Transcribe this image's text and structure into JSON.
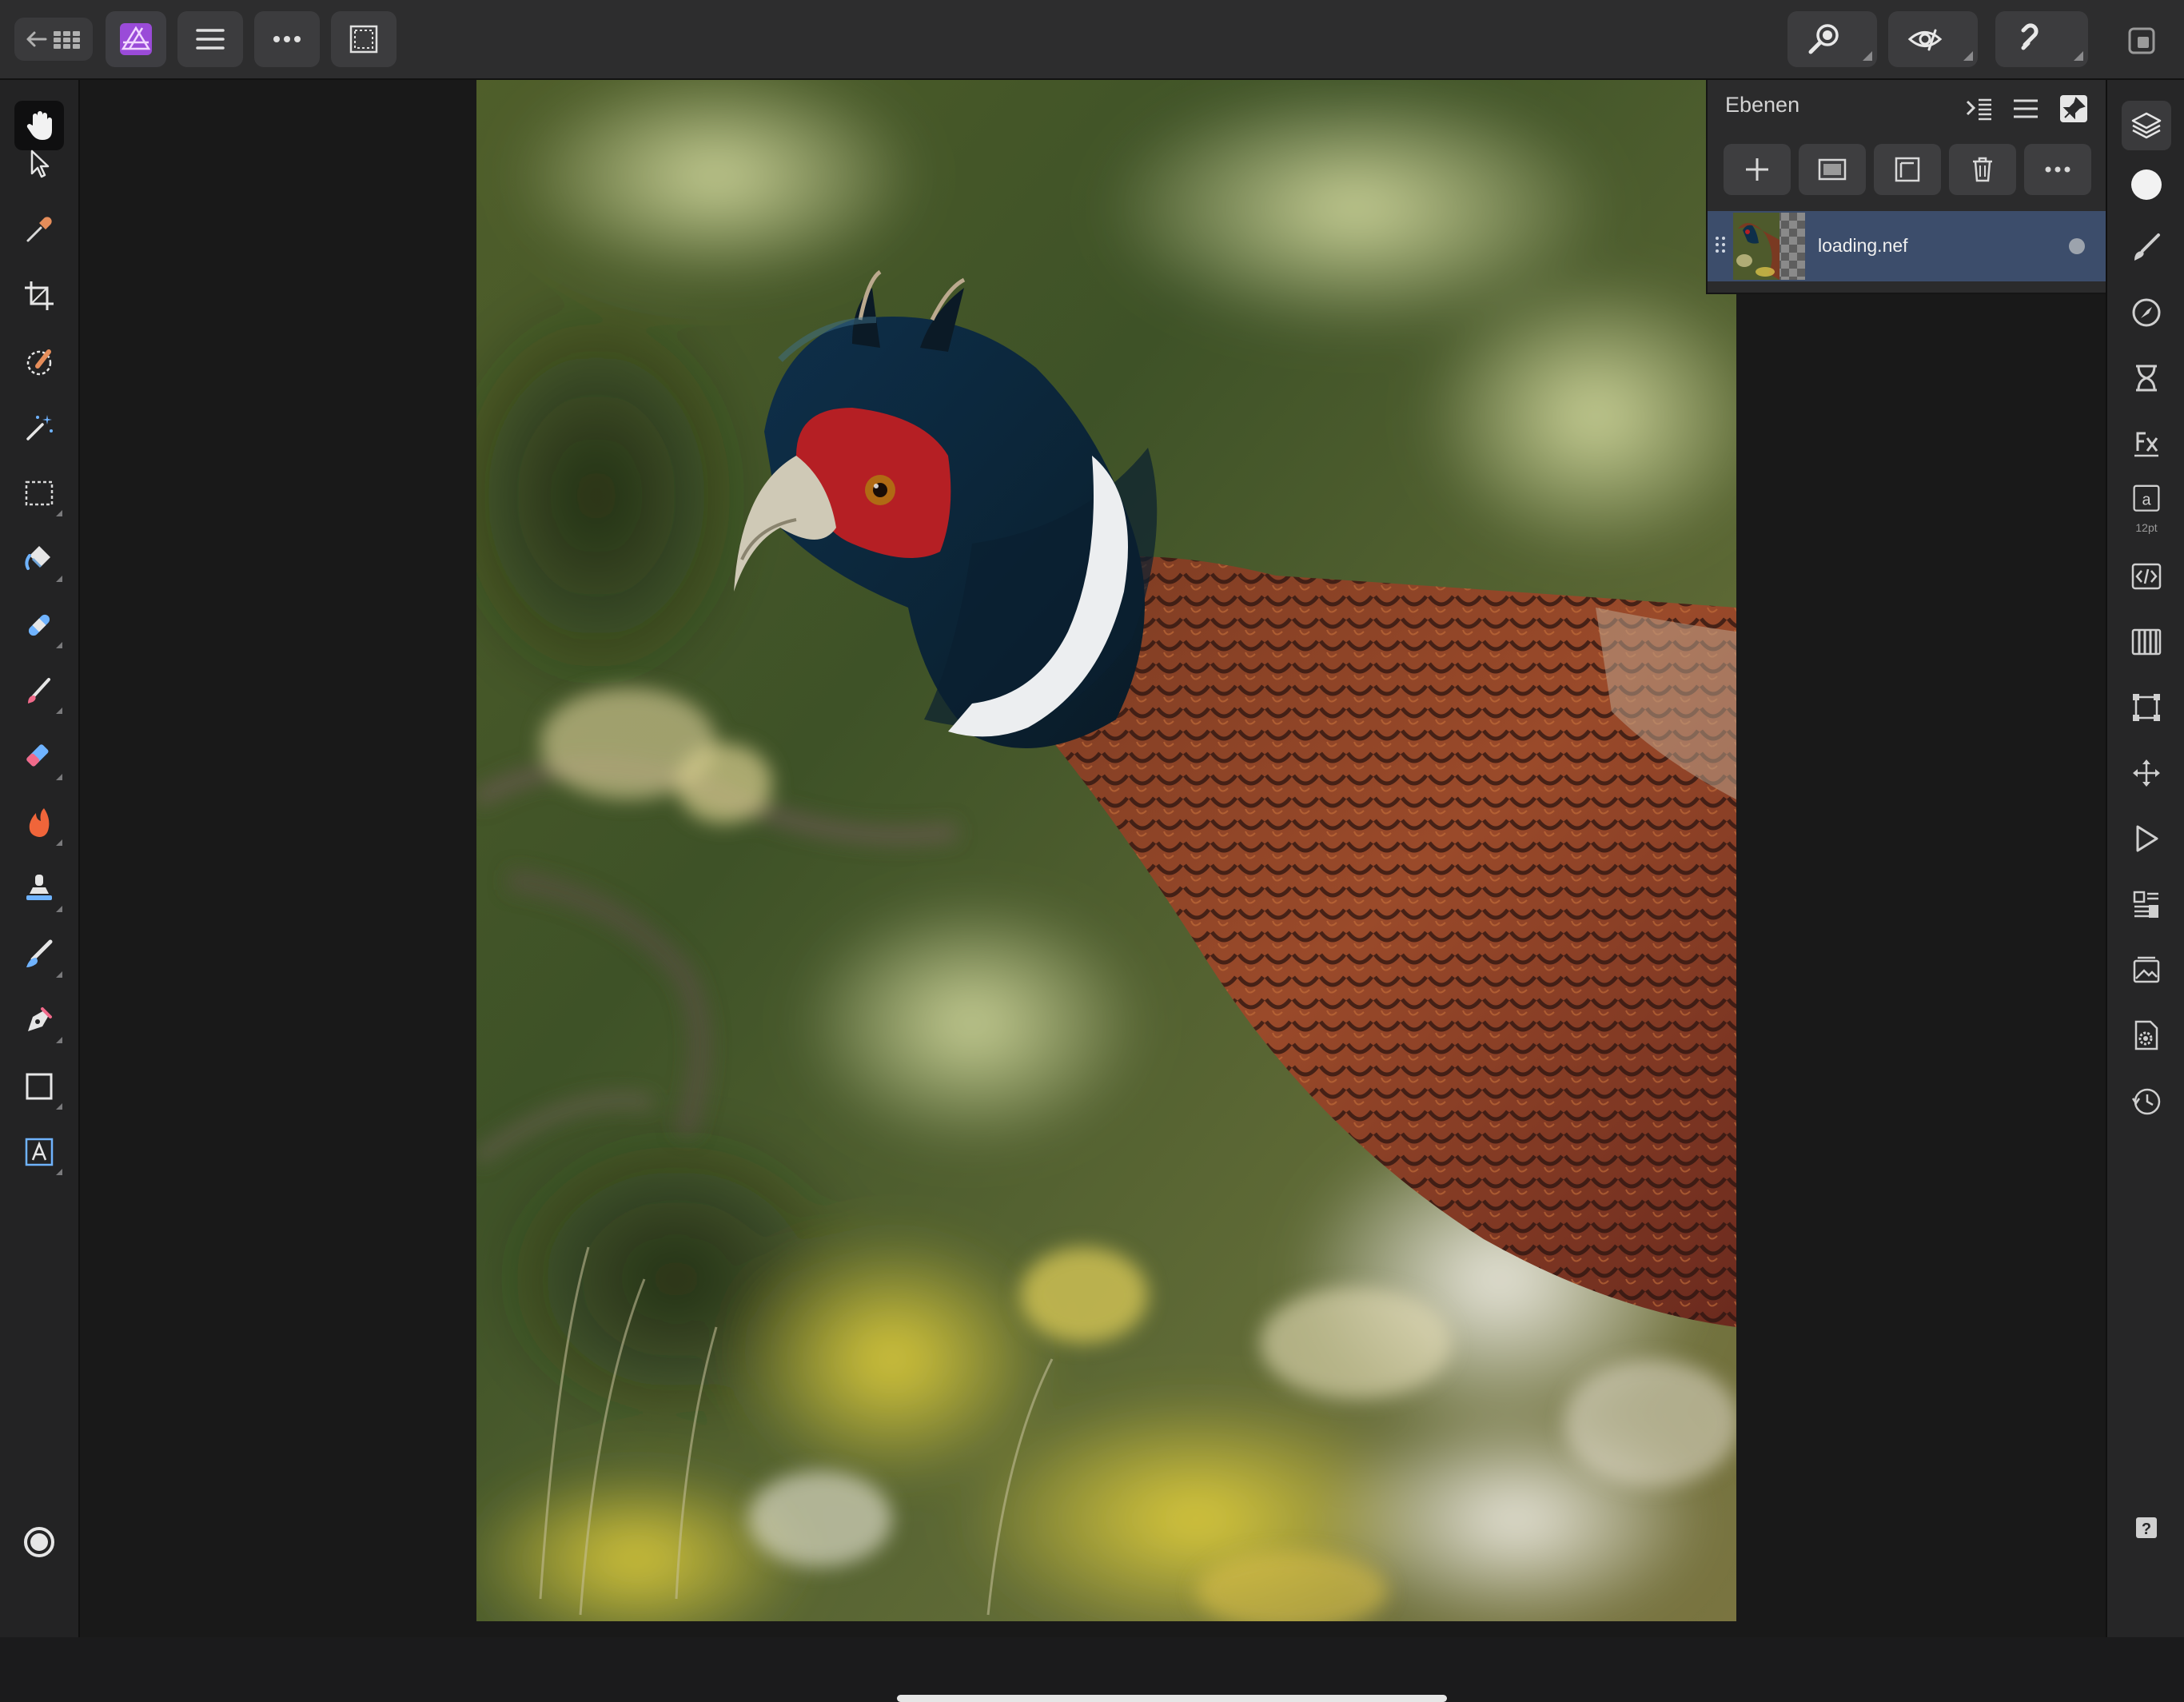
{
  "app": {
    "accent_color": "#9a4bd8",
    "selection_color": "#3c4d6b"
  },
  "topbar": {
    "left_buttons": [
      "back-to-gallery",
      "photo-persona",
      "main-menu",
      "more-options",
      "selection-mode"
    ],
    "right_buttons": [
      "zoom",
      "view-mode",
      "snapping",
      "window-mode"
    ]
  },
  "left_tools": [
    {
      "name": "hand-tool",
      "icon": "hand-icon",
      "active": true
    },
    {
      "name": "move-tool",
      "icon": "arrow-pointer-icon"
    },
    {
      "name": "color-picker-tool",
      "icon": "eyedropper-icon"
    },
    {
      "name": "crop-tool",
      "icon": "crop-icon"
    },
    {
      "name": "selection-brush-tool",
      "icon": "selection-brush-icon"
    },
    {
      "name": "flood-select-tool",
      "icon": "magic-wand-icon"
    },
    {
      "name": "rectangular-marquee-tool",
      "icon": "marquee-icon"
    },
    {
      "name": "flood-fill-tool",
      "icon": "paint-bucket-icon"
    },
    {
      "name": "healing-tool",
      "icon": "bandage-icon"
    },
    {
      "name": "paint-brush-tool",
      "icon": "paint-brush-icon"
    },
    {
      "name": "erase-brush-tool",
      "icon": "eraser-icon"
    },
    {
      "name": "burn-tool",
      "icon": "flame-icon"
    },
    {
      "name": "clone-tool",
      "icon": "stamp-icon"
    },
    {
      "name": "smudge-tool",
      "icon": "smudge-icon"
    },
    {
      "name": "pen-tool",
      "icon": "pen-nib-icon"
    },
    {
      "name": "rectangle-tool",
      "icon": "rectangle-icon"
    },
    {
      "name": "frame-text-tool",
      "icon": "text-frame-icon"
    },
    {
      "name": "color-wheel",
      "icon": "color-circle-icon"
    }
  ],
  "layers_panel": {
    "title": "Ebenen",
    "actions": [
      "add-layer",
      "add-mask",
      "group-layers",
      "delete-layer",
      "more-layer-options"
    ],
    "layers": [
      {
        "name": "loading.nef",
        "visible": true,
        "selected": true
      }
    ]
  },
  "studio": {
    "items": [
      {
        "name": "layers-studio",
        "icon": "layers-icon",
        "active": true
      },
      {
        "name": "color-studio",
        "icon": "white-circle-icon"
      },
      {
        "name": "brushes-studio",
        "icon": "brush-icon"
      },
      {
        "name": "adjustments-studio",
        "icon": "adjustment-dial-icon"
      },
      {
        "name": "filters-studio",
        "icon": "hourglass-icon"
      },
      {
        "name": "effects-studio",
        "icon": "fx-icon"
      },
      {
        "name": "text-styles-studio",
        "icon": "text-a-icon",
        "caption": "12pt"
      },
      {
        "name": "macros-studio",
        "icon": "code-icon"
      },
      {
        "name": "channels-studio",
        "icon": "channels-icon"
      },
      {
        "name": "transform-studio",
        "icon": "transform-icon"
      },
      {
        "name": "navigator-studio",
        "icon": "move-arrows-icon"
      },
      {
        "name": "play-macro-studio",
        "icon": "play-icon"
      },
      {
        "name": "stock-studio",
        "icon": "library-icon"
      },
      {
        "name": "assets-studio",
        "icon": "image-stack-icon"
      },
      {
        "name": "document-settings-studio",
        "icon": "document-gear-icon"
      },
      {
        "name": "history-studio",
        "icon": "history-clock-icon"
      },
      {
        "name": "help",
        "icon": "help-icon"
      }
    ]
  }
}
